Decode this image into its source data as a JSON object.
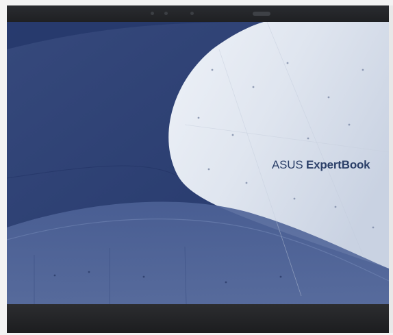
{
  "wallpaper": {
    "brand_light": "ASUS",
    "brand_bold": "ExpertBook",
    "colors": {
      "deep_blue": "#2c3f73",
      "mid_blue": "#4b5f94",
      "concrete_light": "#e3e8f0",
      "bezel": "#222325"
    }
  }
}
